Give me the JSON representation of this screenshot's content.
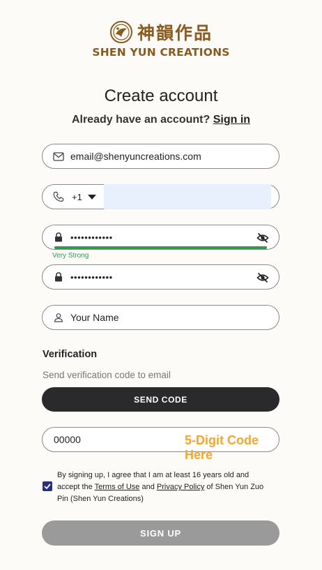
{
  "brand": {
    "chinese_name": "神韻作品",
    "english_name": "SHEN YUN CREATIONS",
    "color": "#8a5a1e"
  },
  "header": {
    "title": "Create account",
    "have_account_text": "Already have an account?",
    "sign_in_link": "Sign in"
  },
  "form": {
    "email": {
      "value": "email@shenyuncreations.com",
      "icon": "mail-icon"
    },
    "phone": {
      "country_code": "+1",
      "icon": "phone-icon",
      "value": ""
    },
    "password": {
      "value": "••••••••••••",
      "icon": "lock-icon",
      "strength_label": "Very Strong",
      "strength": 1.0,
      "strength_color": "#2e9a4e"
    },
    "confirm_password": {
      "value": "••••••••••••",
      "icon": "lock-icon"
    },
    "name": {
      "placeholder": "Your Name",
      "icon": "person-icon"
    }
  },
  "verification": {
    "heading": "Verification",
    "subtext": "Send verification code to email",
    "send_button": "SEND CODE",
    "code_value": "00000",
    "code_hint": "5-Digit Code Here",
    "hint_color": "#f7a52b"
  },
  "agreement": {
    "checked": true,
    "text_before": "By signing up, I agree that I am at least 16 years old and accept the ",
    "terms_link": "Terms of Use",
    "and": " and ",
    "privacy_link": "Privacy Policy",
    "text_after": " of Shen Yun Zuo Pin (Shen Yun Creations)"
  },
  "submit": {
    "label": "SIGN UP"
  }
}
